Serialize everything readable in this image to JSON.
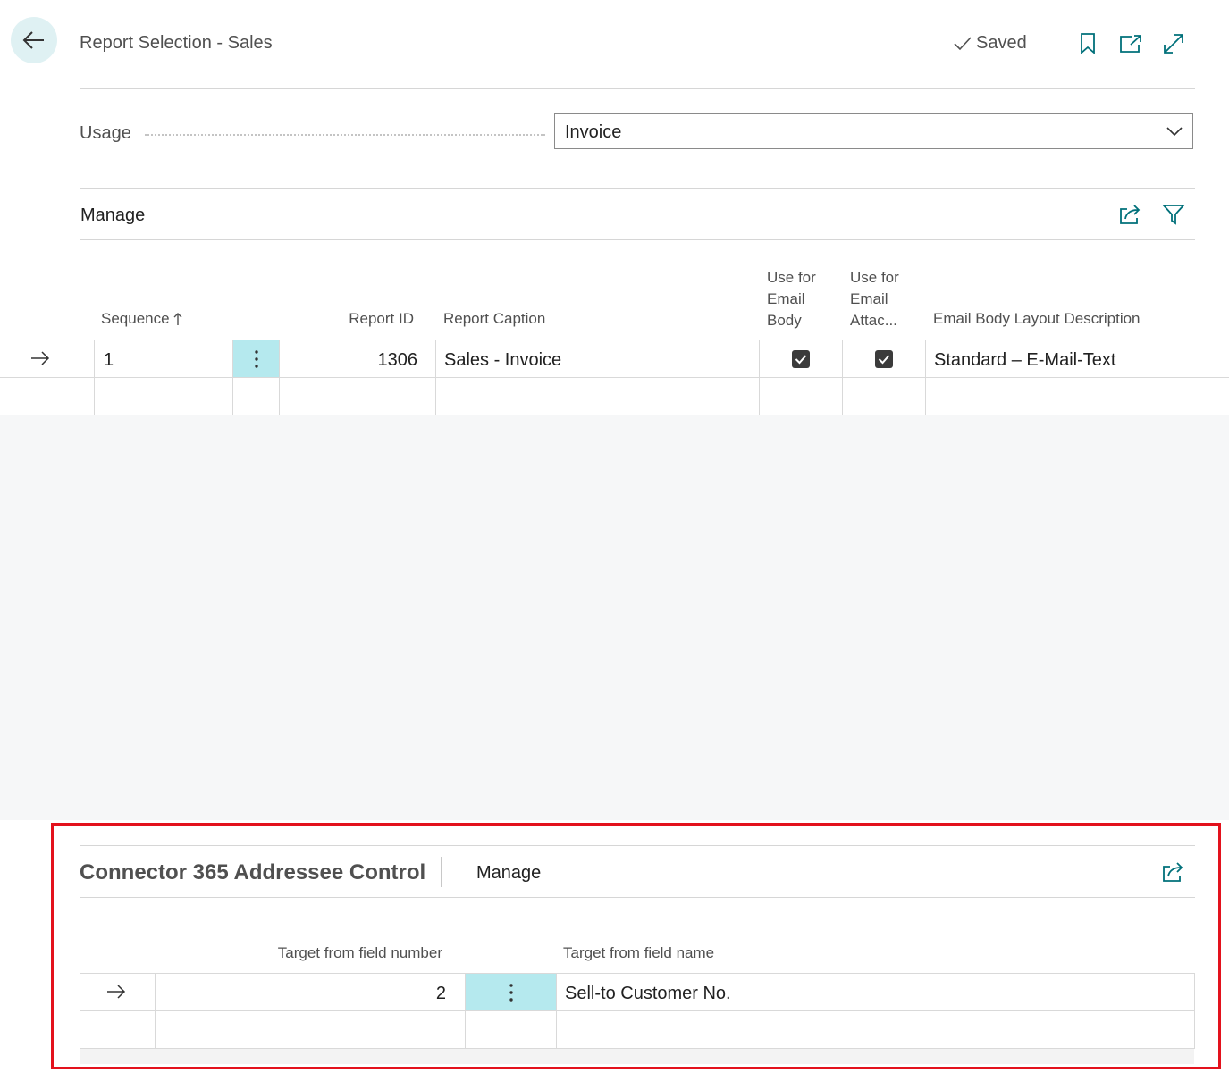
{
  "header": {
    "title": "Report Selection - Sales",
    "saved_label": "Saved",
    "icons": [
      "arrow-left-icon",
      "checkmark-icon",
      "bookmark-icon",
      "open-new-window-icon",
      "expand-icon"
    ]
  },
  "usage": {
    "label": "Usage",
    "value": "Invoice"
  },
  "lines": {
    "manage_label": "Manage",
    "columns": {
      "sequence": "Sequence",
      "report_id": "Report ID",
      "report_caption": "Report Caption",
      "use_email_body": [
        "Use for",
        "Email",
        "Body"
      ],
      "use_email_attach": [
        "Use for",
        "Email",
        "Attac..."
      ],
      "email_body_layout": "Email Body Layout Description"
    },
    "rows": [
      {
        "sequence": "1",
        "report_id": "1306",
        "report_caption": "Sales - Invoice",
        "use_email_body": true,
        "use_email_attach": true,
        "email_body_layout": "Standard – E-Mail-Text"
      }
    ]
  },
  "addressee": {
    "title": "Connector 365 Addressee Control",
    "manage_label": "Manage",
    "columns": {
      "field_number": "Target from field number",
      "field_name": "Target from field name"
    },
    "rows": [
      {
        "field_number": "2",
        "field_name": "Sell-to Customer No."
      }
    ]
  },
  "colors": {
    "accent": "#00707a",
    "selected_cell": "#b5e9ee",
    "highlight_frame": "#e3121d"
  }
}
